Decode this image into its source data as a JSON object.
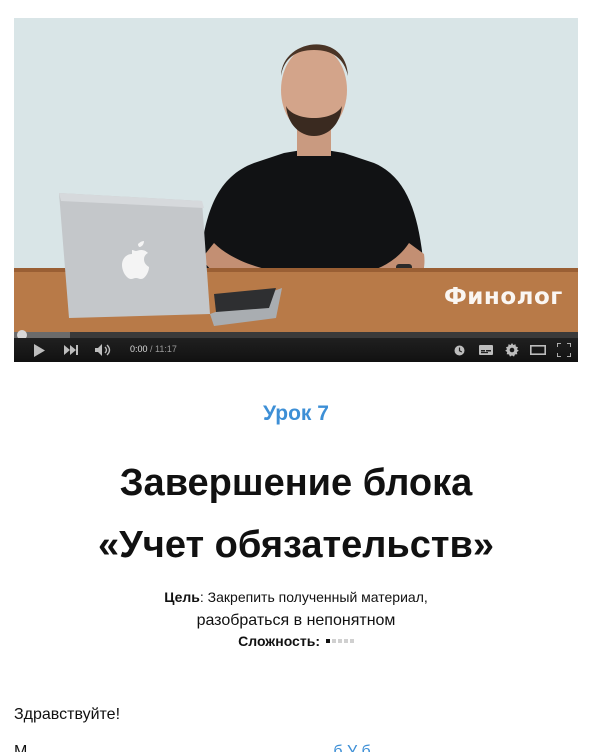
{
  "player": {
    "watermark": "Финолог",
    "time_current": "0:00",
    "time_separator": " / ",
    "time_duration": "11:17",
    "progress_fraction": 0.0,
    "buffer_fraction": 0.1,
    "icons": [
      "play-icon",
      "next-icon",
      "volume-icon",
      "watch-later-icon",
      "subtitles-icon",
      "settings-icon",
      "theater-icon",
      "fullscreen-icon"
    ]
  },
  "lesson": {
    "number_label": "Урок 7",
    "title_line1": "Завершение блока",
    "title_line2": "«Учет обязательств»",
    "goal_label": "Цель",
    "goal_text_1": ": Закрепить полученный материал,",
    "goal_text_2": "разобраться в непонятном",
    "difficulty_label": "Сложность",
    "difficulty_sep": ":",
    "difficulty_level": 1,
    "difficulty_max": 5
  },
  "content": {
    "greeting": "Здравствуйте!",
    "para_start": "М",
    "para_link": "б    У    б"
  },
  "colors": {
    "accent": "#3d8fd6",
    "progress": "#cc181e"
  }
}
